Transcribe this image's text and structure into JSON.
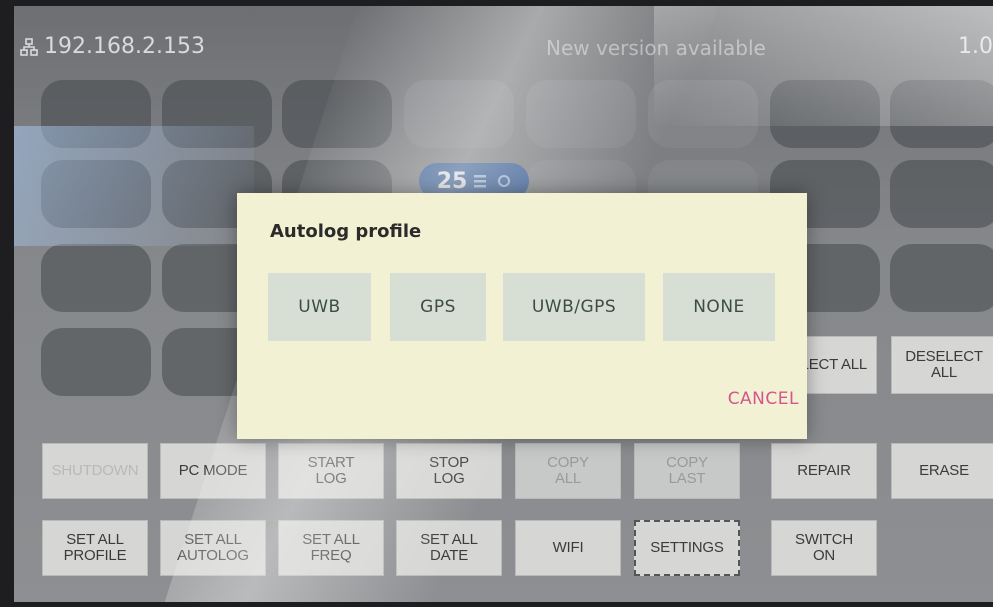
{
  "status": {
    "ip_address": "192.168.2.153",
    "update_notice": "New version available",
    "version": "1.0"
  },
  "badge": {
    "value": "25",
    "icon": "list-icon"
  },
  "dialog": {
    "title": "Autolog profile",
    "options": [
      "UWB",
      "GPS",
      "UWB/GPS",
      "NONE"
    ],
    "cancel": "CANCEL"
  },
  "buttons": {
    "select_all": "SELECT ALL",
    "deselect_all": "DESELECT ALL",
    "shutdown": "SHUTDOWN",
    "pc_mode": "PC MODE",
    "start_log": "START\nLOG",
    "stop_log": "STOP\nLOG",
    "copy_all": "COPY\nALL",
    "copy_last": "COPY\nLAST",
    "repair": "REPAIR",
    "erase": "ERASE",
    "set_all_profile": "SET ALL\nPROFILE",
    "set_all_autolog": "SET ALL\nAUTOLOG",
    "set_all_freq": "SET ALL\nFREQ",
    "set_all_date": "SET ALL\nDATE",
    "wifi": "WIFI",
    "settings": "SETTINGS",
    "switch_on": "SWITCH\nON"
  }
}
